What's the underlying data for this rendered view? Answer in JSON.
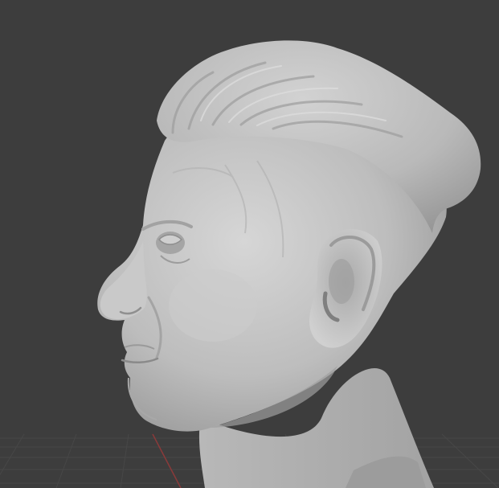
{
  "viewport": {
    "background": "#3d3d3d",
    "grid_color": "#474747",
    "x_axis_color": "#8a3a3a",
    "model_base_color": "#bdbdbd",
    "model_highlight_color": "#d6d6d6",
    "model_shadow_color": "#8e8e8e",
    "model_name": "sculpted-head-bust"
  }
}
